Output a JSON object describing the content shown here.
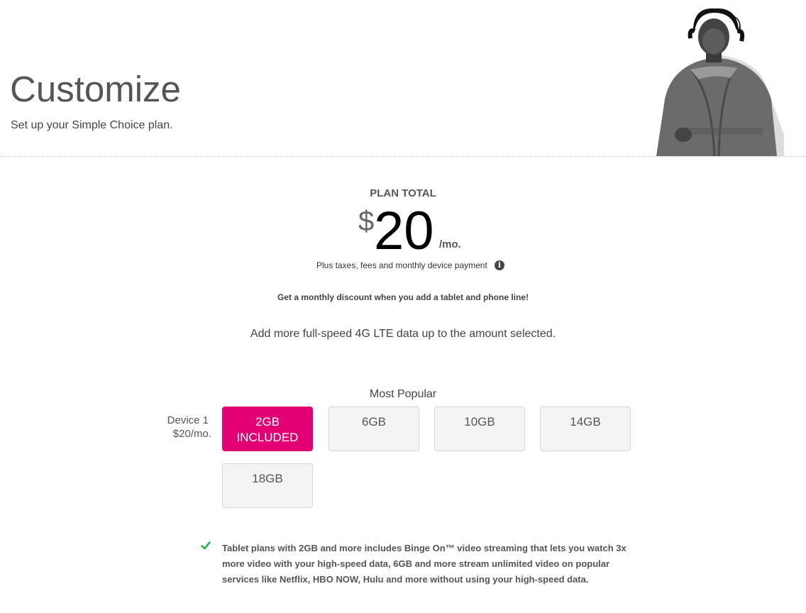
{
  "hero": {
    "title": "Customize",
    "subtitle": "Set up your Simple Choice plan."
  },
  "plan": {
    "total_label": "PLAN TOTAL",
    "currency": "$",
    "amount": "20",
    "period": "/mo.",
    "taxes_note": "Plus taxes, fees and monthly device payment",
    "info_icon": "i"
  },
  "promo": {
    "discount_text": "Get a monthly discount when you add a tablet and phone line!",
    "add_more_text": "Add more full-speed 4G LTE data up to the amount selected."
  },
  "data_options": {
    "popular_label": "Most Popular",
    "device_label": "Device 1",
    "device_price": "$20/mo.",
    "options": [
      {
        "label": "2GB",
        "sublabel": "INCLUDED",
        "selected": true
      },
      {
        "label": "6GB",
        "sublabel": "",
        "selected": false
      },
      {
        "label": "10GB",
        "sublabel": "",
        "selected": false
      },
      {
        "label": "14GB",
        "sublabel": "",
        "selected": false
      },
      {
        "label": "18GB",
        "sublabel": "",
        "selected": false
      }
    ],
    "selected_color": "#e20074"
  },
  "binge_note": {
    "icon": "check-icon",
    "text": "Tablet plans with 2GB and more includes Binge On™ video streaming that lets you watch 3x more video with your high-speed data, 6GB and more stream unlimited video on popular services like Netflix, HBO NOW, Hulu and more without using your high-speed data."
  }
}
